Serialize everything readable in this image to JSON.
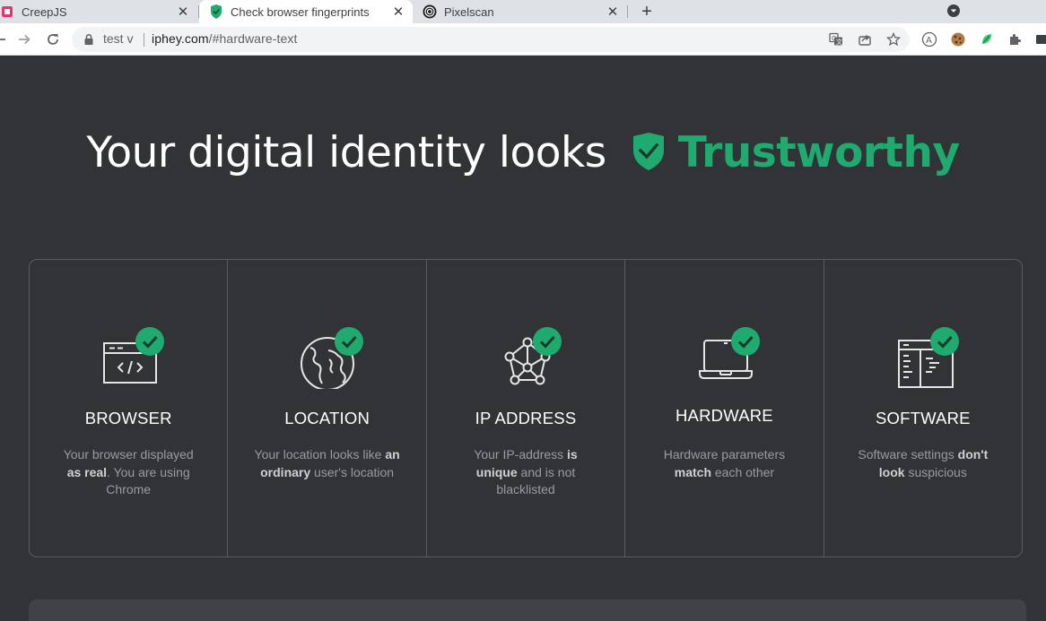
{
  "browser": {
    "tabs": [
      {
        "title": "CreepJS",
        "favicon": "creepjs-icon",
        "active": false
      },
      {
        "title": "Check browser fingerprints",
        "favicon": "iphey-shield-icon",
        "active": true
      },
      {
        "title": "Pixelscan",
        "favicon": "pixelscan-icon",
        "active": false
      }
    ],
    "profile_chip": "test v",
    "url_host": "iphey.com",
    "url_path": "/#hardware-text",
    "accent_color": "#1fab70"
  },
  "hero": {
    "prefix": "Your digital identity looks",
    "verdict": "Trustworthy"
  },
  "cards": [
    {
      "title": "BROWSER",
      "icon": "browser-code-icon",
      "desc": [
        {
          "t": "Your browser displayed "
        },
        {
          "t": "as real",
          "b": true
        },
        {
          "t": ". You are using Chrome"
        }
      ]
    },
    {
      "title": "LOCATION",
      "icon": "globe-icon",
      "desc": [
        {
          "t": "Your location looks like "
        },
        {
          "t": "an ordinary",
          "b": true
        },
        {
          "t": " user's location"
        }
      ]
    },
    {
      "title": "IP ADDRESS",
      "icon": "network-icon",
      "desc": [
        {
          "t": "Your IP-address "
        },
        {
          "t": "is unique",
          "b": true
        },
        {
          "t": " and is not blacklisted"
        }
      ]
    },
    {
      "title": "HARDWARE",
      "icon": "laptop-icon",
      "desc": [
        {
          "t": "Hardware parameters "
        },
        {
          "t": "match",
          "b": true
        },
        {
          "t": " each other"
        }
      ]
    },
    {
      "title": "SOFTWARE",
      "icon": "software-window-icon",
      "desc": [
        {
          "t": "Software settings "
        },
        {
          "t": "don't look",
          "b": true
        },
        {
          "t": " suspicious"
        }
      ]
    }
  ]
}
